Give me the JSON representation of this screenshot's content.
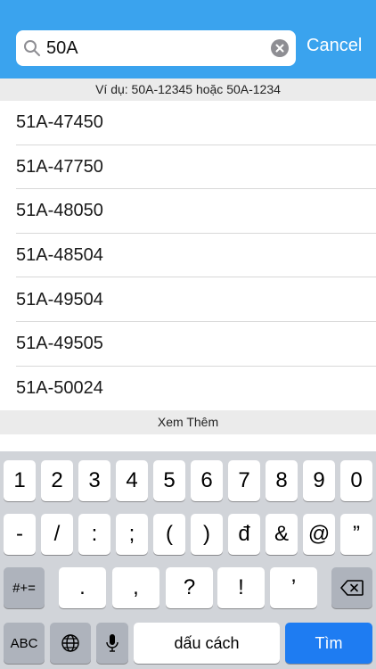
{
  "search": {
    "value": "50A",
    "cancel_label": "Cancel"
  },
  "hint": "Ví dụ: 50A-12345 hoặc 50A-1234",
  "results": [
    "51A-47450",
    "51A-47750",
    "51A-48050",
    "51A-48504",
    "51A-49504",
    "51A-49505",
    "51A-50024"
  ],
  "more_label": "Xem Thêm",
  "keyboard": {
    "row1": [
      "1",
      "2",
      "3",
      "4",
      "5",
      "6",
      "7",
      "8",
      "9",
      "0"
    ],
    "row2": [
      "-",
      "/",
      ":",
      ";",
      "(",
      ")",
      "đ",
      "&",
      "@",
      "”"
    ],
    "row3": [
      "#+=",
      ".",
      ",",
      "?",
      "!",
      "’"
    ],
    "abc_label": "ABC",
    "space_label": "dấu cách",
    "go_label": "Tìm"
  },
  "colors": {
    "header": "#3aa3ee",
    "go_key": "#1e7cf2",
    "keyboard_bg": "#d1d4d9"
  }
}
